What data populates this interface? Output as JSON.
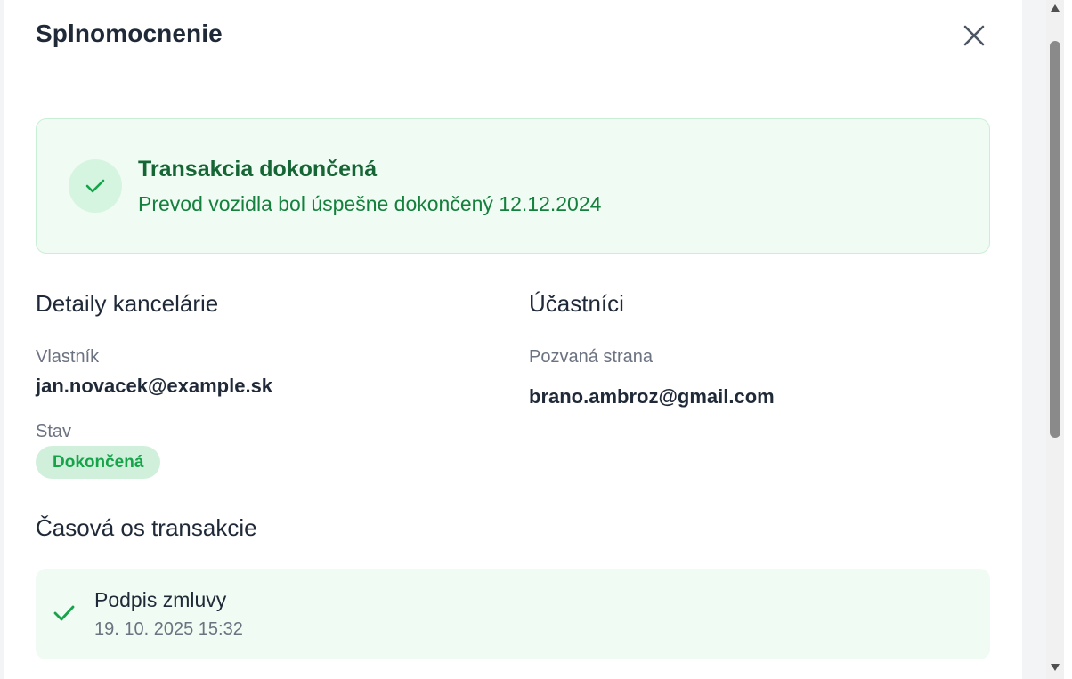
{
  "modal": {
    "title": "Splnomocnenie",
    "close_icon": "close-icon"
  },
  "banner": {
    "icon": "check-icon",
    "title": "Transakcia dokončená",
    "text": "Prevod vozidla bol úspešne dokončený 12.12.2024",
    "accent_color": "#166534",
    "background_color": "#effbf3"
  },
  "office_details": {
    "heading": "Detaily kancelárie",
    "owner_label": "Vlastník",
    "owner_value": "jan.novacek@example.sk",
    "status_label": "Stav",
    "status_value": "Dokončená",
    "status_color": "#16a34a"
  },
  "participants": {
    "heading": "Účastníci",
    "invited_label": "Pozvaná strana",
    "invited_value": "brano.ambroz@gmail.com"
  },
  "timeline": {
    "heading": "Časová os transakcie",
    "items": [
      {
        "icon": "check-icon",
        "title": "Podpis zmluvy",
        "timestamp": "19. 10. 2025 15:32"
      }
    ]
  },
  "scrollbar": {
    "up_icon": "scroll-up-arrow-icon",
    "down_icon": "scroll-down-arrow-icon"
  }
}
